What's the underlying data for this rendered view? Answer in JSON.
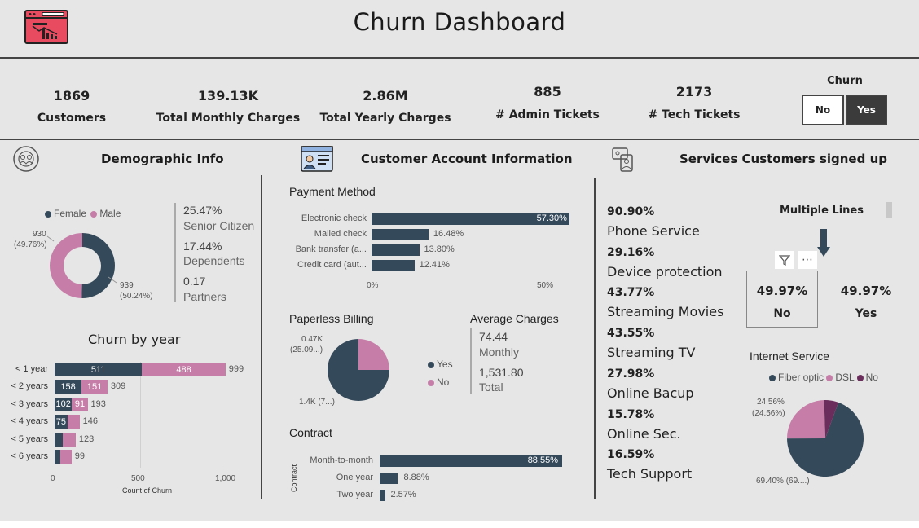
{
  "header": {
    "title": "Churn Dashboard"
  },
  "kpis": [
    {
      "value": "1869",
      "label": "Customers"
    },
    {
      "value": "139.13K",
      "label": "Total Monthly Charges"
    },
    {
      "value": "2.86M",
      "label": "Total Yearly Charges"
    },
    {
      "value": "885",
      "label": "# Admin Tickets"
    },
    {
      "value": "2173",
      "label": "# Tech Tickets"
    }
  ],
  "churn_slicer": {
    "title": "Churn",
    "options": [
      "No",
      "Yes"
    ],
    "selected": "Yes"
  },
  "sections": {
    "demographic": "Demographic Info",
    "account": "Customer Account Information",
    "services": "Services Customers signed up"
  },
  "gender": {
    "legend": [
      "Female",
      "Male"
    ],
    "male_label": "930",
    "male_pct": "(49.76%)",
    "female_label": "939",
    "female_pct": "(50.24%)"
  },
  "demo_stats": [
    {
      "pct": "25.47%",
      "label": "Senior Citizen"
    },
    {
      "pct": "17.44%",
      "label": "Dependents"
    },
    {
      "pct": "0.17",
      "label": "Partners"
    }
  ],
  "churn_by_year": {
    "title": "Churn by year",
    "xlabel": "Count of Churn",
    "ticks": [
      "0",
      "500",
      "1,000"
    ]
  },
  "payment": {
    "title": "Payment Method",
    "ticks": [
      "0%",
      "50%"
    ]
  },
  "paperless": {
    "title": "Paperless Billing",
    "legend": [
      "Yes",
      "No"
    ],
    "label_no": "0.47K",
    "label_no_pct": "(25.09...)",
    "label_yes": "1.4K (7...)"
  },
  "avg_charges": {
    "title": "Average Charges",
    "monthly_value": "74.44",
    "monthly_label": "Monthly",
    "total_value": "1,531.80",
    "total_label": "Total"
  },
  "contract": {
    "title": "Contract",
    "axis_label": "Contract"
  },
  "services_list": [
    {
      "pct": "90.90%",
      "label": "Phone Service"
    },
    {
      "pct": "29.16%",
      "label": "Device protection"
    },
    {
      "pct": "43.77%",
      "label": "Streaming Movies"
    },
    {
      "pct": "43.55%",
      "label": "Streaming TV"
    },
    {
      "pct": "27.98%",
      "label": "Online Bacup"
    },
    {
      "pct": "15.78%",
      "label": "Online Sec."
    },
    {
      "pct": "16.59%",
      "label": "Tech Support"
    }
  ],
  "multiple_lines": {
    "title": "Multiple Lines",
    "no_pct": "49.97%",
    "no_label": "No",
    "yes_pct": "49.97%",
    "yes_label": "Yes"
  },
  "internet": {
    "title": "Internet Service",
    "legend": [
      "Fiber optic",
      "DSL",
      "No"
    ],
    "dsl_label": "24.56%",
    "dsl_label_pct": "(24.56%)",
    "fiber_label": "69.40% (69....)"
  },
  "colors": {
    "dark": "#34495a",
    "pink": "#c67ea9",
    "purple": "#6b2d5c",
    "icon_red": "#e84a5f"
  },
  "chart_data": [
    {
      "type": "pie",
      "subtype": "donut",
      "legend": [
        "Female",
        "Male"
      ],
      "slices": [
        {
          "name": "Female",
          "value": 939,
          "percent": 50.24
        },
        {
          "name": "Male",
          "value": 930,
          "percent": 49.76
        }
      ]
    },
    {
      "type": "bar",
      "orientation": "horizontal",
      "stacked": true,
      "title": "Churn by year",
      "xlabel": "Count of Churn",
      "xlim": [
        0,
        1000
      ],
      "categories": [
        "< 1 year",
        "< 2 years",
        "< 3 years",
        "< 4 years",
        "< 5 years",
        "< 6 years"
      ],
      "series": [
        {
          "values": [
            511,
            158,
            102,
            75,
            48,
            34
          ],
          "labels": [
            "511",
            "158",
            "102",
            "75",
            "",
            ""
          ]
        },
        {
          "values": [
            488,
            151,
            91,
            71,
            75,
            65
          ],
          "labels": [
            "488",
            "151",
            "91",
            "",
            "",
            ""
          ]
        }
      ],
      "totals": [
        999,
        309,
        193,
        146,
        123,
        99
      ]
    },
    {
      "type": "bar",
      "orientation": "horizontal",
      "title": "Payment Method",
      "xlim": [
        0,
        65
      ],
      "categories": [
        "Electronic check",
        "Mailed check",
        "Bank transfer (a...",
        "Credit card (aut..."
      ],
      "values": [
        57.3,
        16.48,
        13.8,
        12.41
      ],
      "value_labels": [
        "57.30%",
        "16.48%",
        "13.80%",
        "12.41%"
      ]
    },
    {
      "type": "pie",
      "title": "Paperless Billing",
      "slices": [
        {
          "name": "Yes",
          "value": 1.4,
          "percent": 74.91
        },
        {
          "name": "No",
          "value": 0.47,
          "percent": 25.09
        }
      ]
    },
    {
      "type": "bar",
      "orientation": "horizontal",
      "title": "Contract",
      "ylabel": "Contract",
      "xlim": [
        0,
        100
      ],
      "categories": [
        "Month-to-month",
        "One year",
        "Two year"
      ],
      "values": [
        88.55,
        8.88,
        2.57
      ],
      "value_labels": [
        "88.55%",
        "8.88%",
        "2.57%"
      ]
    },
    {
      "type": "pie",
      "title": "Internet Service",
      "legend": [
        "Fiber optic",
        "DSL",
        "No"
      ],
      "slices": [
        {
          "name": "Fiber optic",
          "percent": 69.4
        },
        {
          "name": "DSL",
          "percent": 24.56
        },
        {
          "name": "No",
          "percent": 6.04
        }
      ]
    }
  ]
}
